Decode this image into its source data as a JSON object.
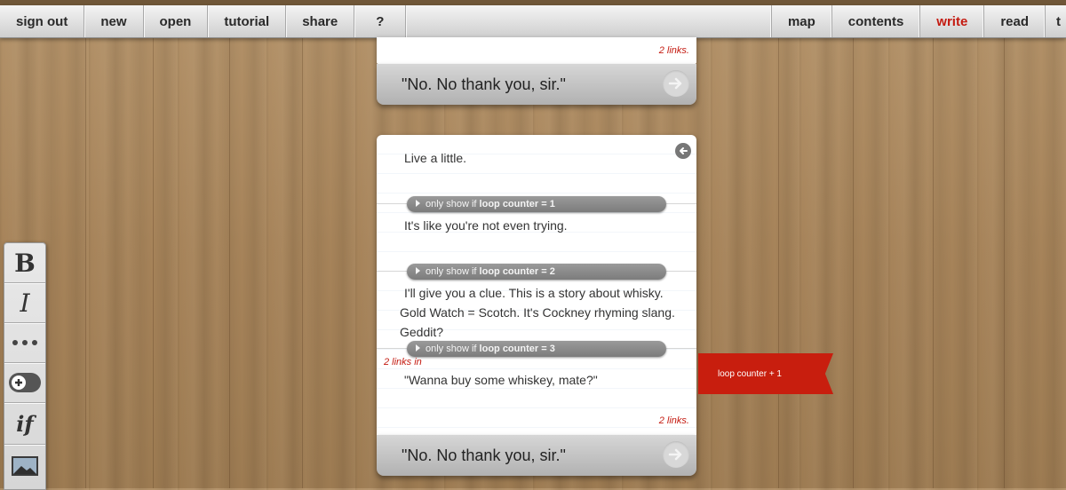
{
  "nav": {
    "left": [
      "sign out",
      "new",
      "open",
      "tutorial",
      "share",
      "?"
    ],
    "right": [
      "map",
      "contents",
      "write",
      "read",
      "t"
    ],
    "active": "write"
  },
  "top_card": {
    "links_note": "2 links.",
    "choice": "\"No. No thank you, sir.\""
  },
  "main_card": {
    "intro": "Live a little.",
    "conditions": [
      {
        "prefix": "only show if",
        "bold": "loop counter = 1",
        "text": "It's like you're not even trying."
      },
      {
        "prefix": "only show if",
        "bold": "loop counter = 2",
        "text": "I'll give you a clue. This is a story about whisky. Gold Watch = Scotch. It's Cockney rhyming slang. Geddit?"
      },
      {
        "prefix": "only show if",
        "bold": "loop counter = 3",
        "text": "\"Wanna buy some whiskey, mate?\""
      }
    ],
    "links_in": "2 links in",
    "links_note": "2 links.",
    "choice": "\"No. No thank you, sir.\""
  },
  "ribbon": {
    "label": "loop counter + 1",
    "color": "#c81e0e"
  },
  "toolbar": [
    "bold",
    "italic",
    "more",
    "add",
    "if",
    "image"
  ],
  "colors": {
    "accent_red": "#c41a10"
  }
}
